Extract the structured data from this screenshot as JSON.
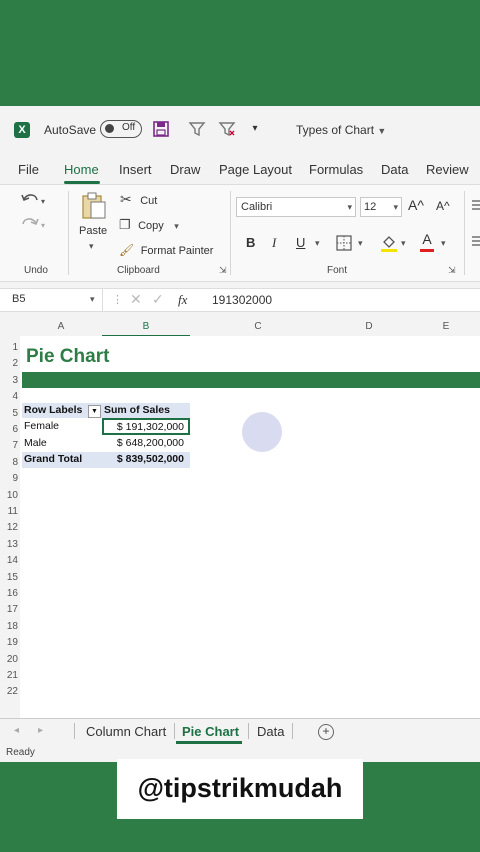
{
  "titlebar": {
    "app_icon": "X",
    "autosave_label": "AutoSave",
    "autosave_state": "Off",
    "doc_title": "Types of Chart"
  },
  "menu": [
    "File",
    "Home",
    "Insert",
    "Draw",
    "Page Layout",
    "Formulas",
    "Data",
    "Review"
  ],
  "ribbon": {
    "undo_label": "Undo",
    "clipboard": {
      "paste": "Paste",
      "cut": "Cut",
      "copy": "Copy",
      "format_painter": "Format Painter",
      "group": "Clipboard"
    },
    "font": {
      "name": "Calibri",
      "size": "12",
      "bold": "B",
      "italic": "I",
      "underline": "U",
      "grow": "A^",
      "shrink": "A^",
      "color_letter": "A",
      "group": "Font"
    }
  },
  "formula_bar": {
    "name_box": "B5",
    "fx": "fx",
    "value": "191302000"
  },
  "columns": [
    "A",
    "B",
    "C",
    "D",
    "E"
  ],
  "rows": [
    "1",
    "2",
    "3",
    "4",
    "5",
    "6",
    "7",
    "8",
    "9",
    "10",
    "11",
    "12",
    "13",
    "14",
    "15",
    "16",
    "17",
    "18",
    "19",
    "20",
    "21",
    "22"
  ],
  "sheet": {
    "title": "Pie Chart",
    "pivot": {
      "header": [
        "Row Labels",
        "Sum of Sales"
      ],
      "rows": [
        {
          "label": "Female",
          "value": "$ 191,302,000"
        },
        {
          "label": "Male",
          "value": "$ 648,200,000"
        }
      ],
      "total": {
        "label": "Grand Total",
        "value": "$ 839,502,000"
      }
    }
  },
  "tabs": [
    "Column Chart",
    "Pie Chart",
    "Data"
  ],
  "status": "Ready",
  "watermark": "@tipstrikmudah"
}
